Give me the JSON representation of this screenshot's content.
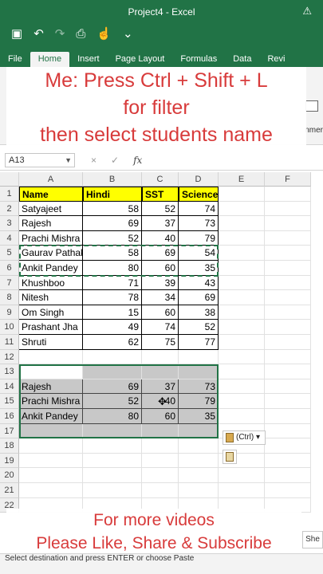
{
  "window": {
    "title": "Project4  -  Excel"
  },
  "qat": {
    "save_icon": "save-icon",
    "undo_icon": "undo-icon",
    "redo_icon": "redo-icon",
    "preview_icon": "print-preview-icon",
    "touch_icon": "touch-mode-icon",
    "more_icon": "more-icon"
  },
  "tabs": [
    {
      "label": "File"
    },
    {
      "label": "Home"
    },
    {
      "label": "Insert"
    },
    {
      "label": "Page Layout"
    },
    {
      "label": "Formulas"
    },
    {
      "label": "Data"
    },
    {
      "label": "Revi"
    }
  ],
  "ribbon": {
    "partial_text": "nmer"
  },
  "overlay_top": {
    "line1": "Me: Press Ctrl + Shift + L",
    "line2": "for filter",
    "line3": "then select students name"
  },
  "formula_bar": {
    "name_box": "A13",
    "cancel": "×",
    "enter": "✓",
    "fx": "fx"
  },
  "columns": [
    "A",
    "B",
    "C",
    "D",
    "E",
    "F"
  ],
  "rows": [
    "1",
    "2",
    "3",
    "4",
    "5",
    "6",
    "7",
    "8",
    "9",
    "10",
    "11",
    "12",
    "13",
    "14",
    "15",
    "16",
    "17",
    "18",
    "19",
    "20",
    "21",
    "22"
  ],
  "table": {
    "headers": [
      "Name",
      "Hindi",
      "SST",
      "Science"
    ],
    "rows": [
      [
        "Satyajeet",
        "58",
        "52",
        "74"
      ],
      [
        "Rajesh",
        "69",
        "37",
        "73"
      ],
      [
        "Prachi Mishra",
        "52",
        "40",
        "79"
      ],
      [
        "Gaurav Pathak",
        "58",
        "69",
        "54"
      ],
      [
        "Ankit Pandey",
        "80",
        "60",
        "35"
      ],
      [
        "Khushboo",
        "71",
        "39",
        "43"
      ],
      [
        "Nitesh",
        "78",
        "34",
        "69"
      ],
      [
        "Om Singh",
        "15",
        "60",
        "38"
      ],
      [
        "Prashant Jha",
        "49",
        "74",
        "52"
      ],
      [
        "Shruti",
        "62",
        "75",
        "77"
      ]
    ]
  },
  "pasted": {
    "rows": [
      [
        "Rajesh",
        "69",
        "37",
        "73"
      ],
      [
        "Prachi Mishra",
        "52",
        "40",
        "79"
      ],
      [
        "Ankit Pandey",
        "80",
        "60",
        "35"
      ]
    ]
  },
  "paste_options": {
    "label": "(Ctrl)"
  },
  "overlay_bottom": {
    "line1": "For more videos",
    "line2": "Please Like, Share & Subscribe"
  },
  "status_bar": {
    "text": "Select destination and press ENTER or choose Paste"
  },
  "sheet_tab_stub": "She"
}
